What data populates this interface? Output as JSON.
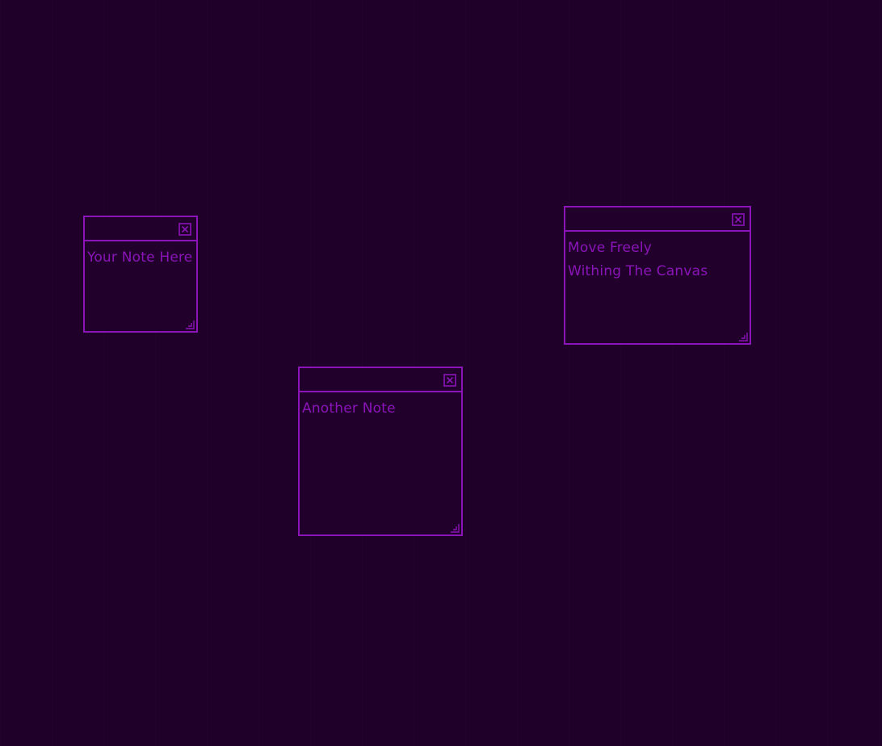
{
  "canvas": {
    "background_color": "#1f0029",
    "accent_color": "#8a14b8"
  },
  "notes": [
    {
      "lines": [
        "Your Note Here"
      ],
      "close_icon": "close-box-icon",
      "resize_icon": "resize-grip-icon"
    },
    {
      "lines": [
        "Another Note"
      ],
      "close_icon": "close-box-icon",
      "resize_icon": "resize-grip-icon"
    },
    {
      "lines": [
        "Move Freely",
        "Withing The Canvas"
      ],
      "close_icon": "close-box-icon",
      "resize_icon": "resize-grip-icon"
    }
  ]
}
